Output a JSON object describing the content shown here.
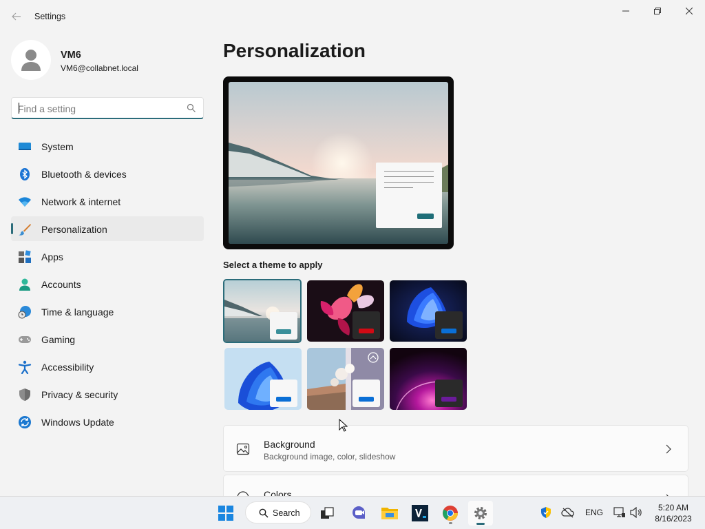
{
  "window": {
    "app_title": "Settings",
    "back_icon": "arrow-left-icon",
    "controls": [
      "minimize-icon",
      "restore-icon",
      "close-icon"
    ]
  },
  "profile": {
    "name": "VM6",
    "email": "VM6@collabnet.local"
  },
  "search": {
    "placeholder": "Find a setting",
    "value": ""
  },
  "nav": {
    "items": [
      {
        "label": "System",
        "icon": "system-display-icon",
        "active": false
      },
      {
        "label": "Bluetooth & devices",
        "icon": "bluetooth-icon",
        "active": false
      },
      {
        "label": "Network & internet",
        "icon": "wifi-icon",
        "active": false
      },
      {
        "label": "Personalization",
        "icon": "paintbrush-icon",
        "active": true
      },
      {
        "label": "Apps",
        "icon": "apps-icon",
        "active": false
      },
      {
        "label": "Accounts",
        "icon": "accounts-icon",
        "active": false
      },
      {
        "label": "Time & language",
        "icon": "globe-clock-icon",
        "active": false
      },
      {
        "label": "Gaming",
        "icon": "gamepad-icon",
        "active": false
      },
      {
        "label": "Accessibility",
        "icon": "accessibility-icon",
        "active": false
      },
      {
        "label": "Privacy & security",
        "icon": "shield-icon",
        "active": false
      },
      {
        "label": "Windows Update",
        "icon": "windows-update-icon",
        "active": false
      }
    ]
  },
  "main": {
    "title": "Personalization",
    "theme_section_label": "Select a theme to apply",
    "themes": [
      {
        "name": "theme-glow-lake",
        "selected": true,
        "accent": "#3a8f9a"
      },
      {
        "name": "theme-captured-motion",
        "selected": false,
        "accent": "#d10a14"
      },
      {
        "name": "theme-windows-dark",
        "selected": false,
        "accent": "#0a6fd6"
      },
      {
        "name": "theme-windows-light",
        "selected": false,
        "accent": "#0a6fd6"
      },
      {
        "name": "theme-flowers-spotlight",
        "selected": false,
        "accent": "#0a6fd6"
      },
      {
        "name": "theme-sunrise-dark",
        "selected": false,
        "accent": "#6a1b9a"
      }
    ],
    "cards": [
      {
        "title": "Background",
        "subtitle": "Background image, color, slideshow",
        "icon": "image-icon"
      },
      {
        "title": "Colors",
        "subtitle": "",
        "icon": "palette-icon"
      }
    ]
  },
  "taskbar": {
    "search_label": "Search",
    "apps": [
      "start-icon",
      "task-view-icon",
      "teams-chat-icon",
      "file-explorer-icon",
      "vmware-icon",
      "chrome-icon",
      "settings-icon"
    ],
    "tray": {
      "language": "ENG",
      "time": "5:20 AM",
      "date": "8/16/2023"
    }
  },
  "colors": {
    "accent": "#2b6c7a",
    "background": "#f3f3f3"
  }
}
